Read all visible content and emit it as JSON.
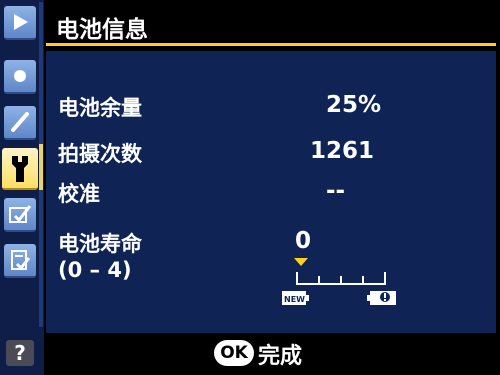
{
  "screen": {
    "title": "电池信息"
  },
  "rows": {
    "charge_label": "电池余量",
    "charge_value": "25%",
    "shots_label": "拍摄次数",
    "shots_value": "1261",
    "calibration_label": "校准",
    "calibration_value": "--",
    "life_label": "电池寿命",
    "life_range": "(0 – 4)",
    "life_value": "0"
  },
  "gauge": {
    "new_label": "NEW",
    "level": 0,
    "max": 4
  },
  "footer": {
    "ok_button": "OK",
    "ok_text": "完成"
  },
  "sidebar": {
    "items": [
      "playback-icon",
      "shooting-icon",
      "custom-settings-icon",
      "setup-wrench-icon",
      "retouch-icon",
      "my-menu-icon"
    ],
    "help": "?"
  },
  "colors": {
    "accent": "#ffcf21",
    "panel": "#0f2355",
    "sidebar": "#0e1e48"
  }
}
